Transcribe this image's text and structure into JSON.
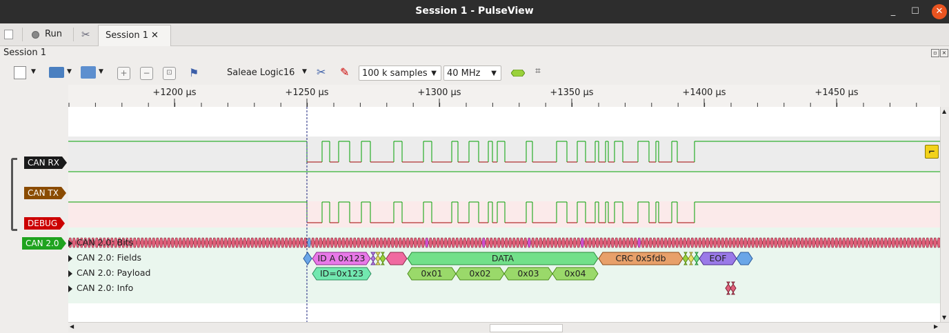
{
  "window": {
    "title": "Session 1 - PulseView",
    "minimize": "_",
    "maximize": "☐",
    "close": "✕"
  },
  "tabs": {
    "run_label": "Run",
    "session_tab": "Session 1",
    "session_tab_close": "✕"
  },
  "session": {
    "label": "Session 1"
  },
  "toolbar": {
    "device": "Saleae Logic16",
    "samples": "100 k samples",
    "samplerate": "40 MHz"
  },
  "ruler": {
    "ticks": [
      {
        "label": "+1200 µs"
      },
      {
        "label": "+1250 µs"
      },
      {
        "label": "+1300 µs"
      },
      {
        "label": "+1350 µs"
      },
      {
        "label": "+1400 µs"
      },
      {
        "label": "+1450 µs"
      }
    ]
  },
  "channels": [
    {
      "name": "CAN RX",
      "color": "#1a1a1a"
    },
    {
      "name": "CAN TX",
      "color": "#8a4b00"
    },
    {
      "name": "DEBUG",
      "color": "#cc0000"
    }
  ],
  "decoder": {
    "name": "CAN 2.0",
    "color": "#1fa31f",
    "rows": [
      {
        "label": "CAN 2.0: Bits"
      },
      {
        "label": "CAN 2.0: Fields"
      },
      {
        "label": "CAN 2.0: Payload"
      },
      {
        "label": "CAN 2.0: Info"
      }
    ]
  },
  "fields": {
    "id": "ID A 0x123",
    "data": "DATA",
    "crc": "CRC 0x5fdb",
    "eof": "EOF"
  },
  "payload": {
    "id": "ID=0x123",
    "bytes": [
      "0x01",
      "0x02",
      "0x03",
      "0x04"
    ]
  },
  "colors": {
    "trace_high": "#00a000",
    "trace_low": "#a00000",
    "cursor": "#1a237e"
  }
}
